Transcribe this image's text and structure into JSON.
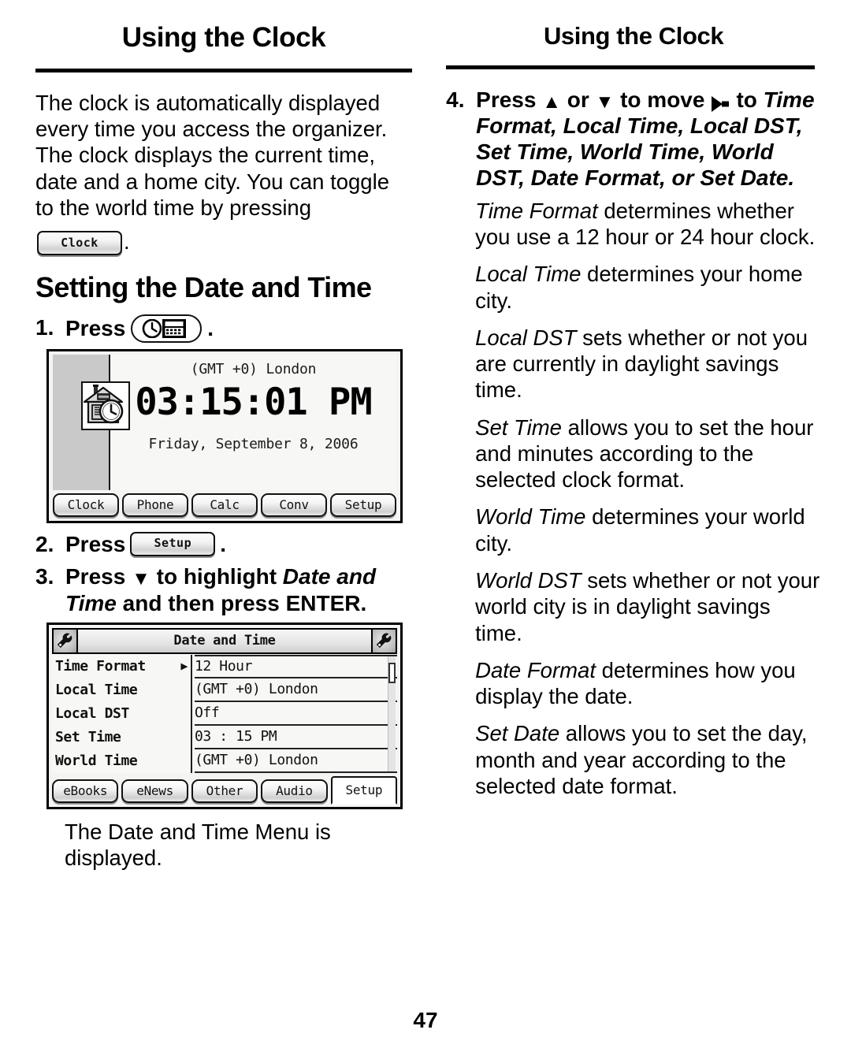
{
  "page": {
    "number": "47"
  },
  "left_column": {
    "header": "Using the Clock",
    "intro_paragraph": "The clock is automatically displayed every time you access the organizer. The clock displays the current time, date and a home city. You can toggle to the world time by pressing",
    "intro_key_label": "Clock",
    "intro_period": ".",
    "section_heading": "Setting the Date and Time",
    "steps": [
      {
        "number": "1.",
        "text_before": "Press",
        "key_label": "clock-calculator-icon",
        "text_after": "."
      },
      {
        "number": "2.",
        "text_before": "Press",
        "key_label": "Setup",
        "text_after": "."
      },
      {
        "number": "3.",
        "text_before": "Press",
        "arrow": "▼",
        "text_mid": "to highlight",
        "italic_part": "Date and Time",
        "text_after": "and then press ENTER."
      }
    ],
    "caption": "The Date and Time Menu is displayed."
  },
  "clock_screen": {
    "home_icon": "house-clock-icon",
    "city": "(GMT +0) London",
    "time": "03:15:01 PM",
    "date": "Friday, September  8, 2006",
    "tabs": [
      {
        "label": "Clock",
        "active": false
      },
      {
        "label": "Phone",
        "active": false
      },
      {
        "label": "Calc",
        "active": false
      },
      {
        "label": "Conv",
        "active": false
      },
      {
        "label": "Setup",
        "active": false
      }
    ]
  },
  "menu_screen": {
    "title": "Date and Time",
    "left_icon": "wrench-icon",
    "right_icon": "wrench-icon",
    "rows": [
      {
        "label": "Time Format",
        "value": "12 Hour",
        "selected": true
      },
      {
        "label": "Local Time",
        "value": "(GMT +0) London",
        "selected": false
      },
      {
        "label": "Local DST",
        "value": "Off",
        "selected": false
      },
      {
        "label": "Set Time",
        "value": "03 : 15 PM",
        "selected": false
      },
      {
        "label": "World Time",
        "value": "(GMT +0) London",
        "selected": false
      }
    ],
    "selection_marker": "▶",
    "tabs": [
      {
        "label": "eBooks",
        "active": false
      },
      {
        "label": "eNews",
        "active": false
      },
      {
        "label": "Other",
        "active": false
      },
      {
        "label": "Audio",
        "active": false
      },
      {
        "label": "Setup",
        "active": true
      }
    ]
  },
  "right_column": {
    "header": "Using the Clock",
    "step4": {
      "number": "4.",
      "text_before": "Press",
      "arrow_up": "▲",
      "text_or": "or",
      "arrow_down": "▼",
      "text_move": "to move",
      "pointer_icon": "right-pointer-icon",
      "text_to": "to",
      "italic_list": "Time Format, Local Time, Local DST, Set Time, World Time, World DST, Date Format, or Set Date."
    },
    "definitions": [
      {
        "term": "Time Format",
        "description": "determines whether you use a 12 hour or 24 hour clock."
      },
      {
        "term": "Local Time",
        "description": "determines your home city."
      },
      {
        "term": "Local DST",
        "description": "sets whether or not you are currently in daylight savings time."
      },
      {
        "term": "Set Time",
        "description": "allows you to set the hour and minutes according to the selected clock format."
      },
      {
        "term": "World Time",
        "description": "determines your world city."
      },
      {
        "term": "World DST",
        "description": "sets whether or not your world city is in daylight savings time."
      },
      {
        "term": "Date Format",
        "description": "determines how you display the date."
      },
      {
        "term": "Set Date",
        "description": "allows you to set the day, month and year according to the selected date format."
      }
    ]
  }
}
